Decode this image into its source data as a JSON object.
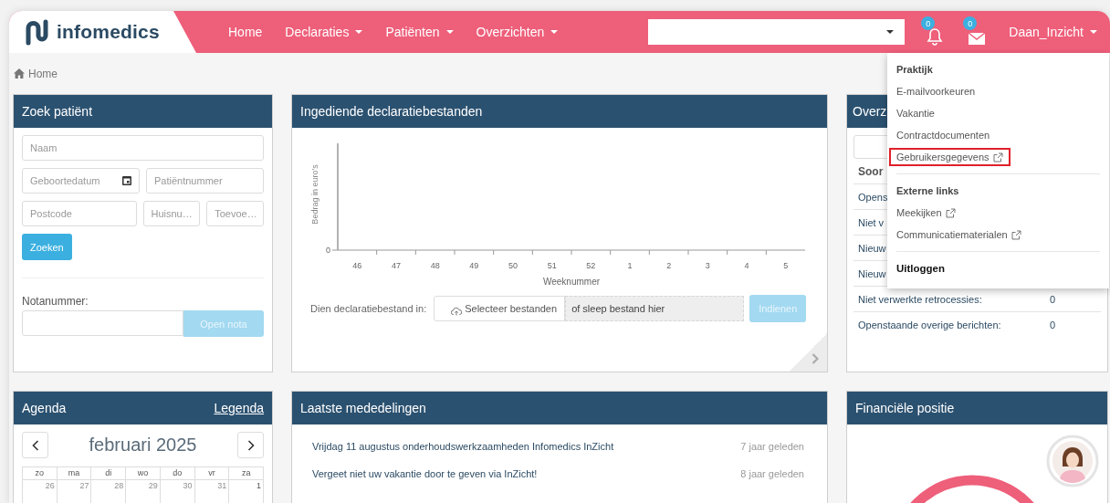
{
  "navbar": {
    "logo": "infomedics",
    "links": [
      {
        "label": "Home",
        "has_menu": false
      },
      {
        "label": "Declaraties",
        "has_menu": true
      },
      {
        "label": "Patiënten",
        "has_menu": true
      },
      {
        "label": "Overzichten",
        "has_menu": true
      }
    ],
    "notifications": [
      {
        "kind": "bell",
        "count": "0"
      },
      {
        "kind": "mail",
        "count": "0"
      }
    ],
    "user": "Daan_Inzicht"
  },
  "breadcrumb": [
    "Home"
  ],
  "search_panel": {
    "title": "Zoek patiënt",
    "field_rows": [
      [
        {
          "kind": "text",
          "placeholder": "Naam"
        }
      ],
      [
        {
          "kind": "date",
          "placeholder": "Geboortedatum"
        },
        {
          "kind": "text",
          "placeholder": "Patiëntnummer"
        }
      ],
      [
        {
          "kind": "text",
          "placeholder": "Postcode"
        },
        {
          "kind": "text",
          "placeholder": "Huisnu…"
        },
        {
          "kind": "text",
          "placeholder": "Toevoe…"
        }
      ]
    ],
    "search_button": {
      "label": "Zoeken",
      "disabled": false
    },
    "note_label": "Notanummer:",
    "note_button": {
      "label": "Open nota",
      "disabled": true
    }
  },
  "declarations_panel": {
    "title": "Ingediende declaratiebestanden",
    "empty_chart": {
      "x_axis_title": "Weeknummer",
      "y_axis_title": "Bedrag in euro's",
      "x_labels": [
        "46",
        "47",
        "48",
        "49",
        "50",
        "51",
        "52",
        "1",
        "2",
        "3",
        "4",
        "5"
      ],
      "y_label": "0"
    },
    "upload_label": "Dien declaratiebestand in:",
    "select_button": "Selecteer bestanden",
    "drop_hint": "of sleep bestand hier",
    "submit_button": {
      "label": "Indienen",
      "disabled": true
    }
  },
  "overview_panel": {
    "title": "Overz",
    "column_1": "Soor",
    "rows": [
      {
        "label": "Opens"
      },
      {
        "label": "Niet v"
      },
      {
        "label": "Nieuw"
      },
      {
        "label": "Nieuw"
      },
      {
        "label": "Niet verwerkte retrocessies:",
        "value": "0"
      },
      {
        "label": "Openstaande overige berichten:",
        "value": "0"
      }
    ]
  },
  "user_menu": {
    "groups": [
      {
        "heading": "Praktijk",
        "kind": "label",
        "items": [
          {
            "label": "E-mailvoorkeuren",
            "external": false,
            "highlighted": false
          },
          {
            "label": "Vakantie",
            "external": false,
            "highlighted": false
          },
          {
            "label": "Contractdocumenten",
            "external": false,
            "highlighted": false
          },
          {
            "label": "Gebruikersgegevens",
            "external": true,
            "highlighted": true
          }
        ]
      },
      {
        "heading": "Externe links",
        "kind": "label",
        "items": [
          {
            "label": "Meekijken",
            "external": true,
            "highlighted": false
          },
          {
            "label": "Communicatiematerialen",
            "external": true,
            "highlighted": false
          }
        ]
      },
      {
        "heading": "Uitloggen",
        "kind": "action"
      }
    ]
  },
  "agenda_panel": {
    "title": "Agenda",
    "legend_link": "Legenda",
    "month": "februari 2025",
    "weekdays": [
      "zo",
      "ma",
      "di",
      "wo",
      "do",
      "vr",
      "za"
    ],
    "days": [
      {
        "label": "26",
        "other_month": true
      },
      {
        "label": "27",
        "other_month": true
      },
      {
        "label": "28",
        "other_month": true
      },
      {
        "label": "29",
        "other_month": true
      },
      {
        "label": "30",
        "other_month": true
      },
      {
        "label": "31",
        "other_month": true
      },
      {
        "label": "1",
        "other_month": false
      }
    ]
  },
  "news_panel": {
    "title": "Laatste mededelingen",
    "items": [
      {
        "text": "Vrijdag 11 augustus onderhoudswerkzaamheden Infomedics InZicht",
        "time": "7 jaar geleden"
      },
      {
        "text": "Vergeet niet uw vakantie door te geven via InZicht!",
        "time": "8 jaar geleden"
      }
    ]
  },
  "finance_panel": {
    "title": "Financiële positie"
  }
}
